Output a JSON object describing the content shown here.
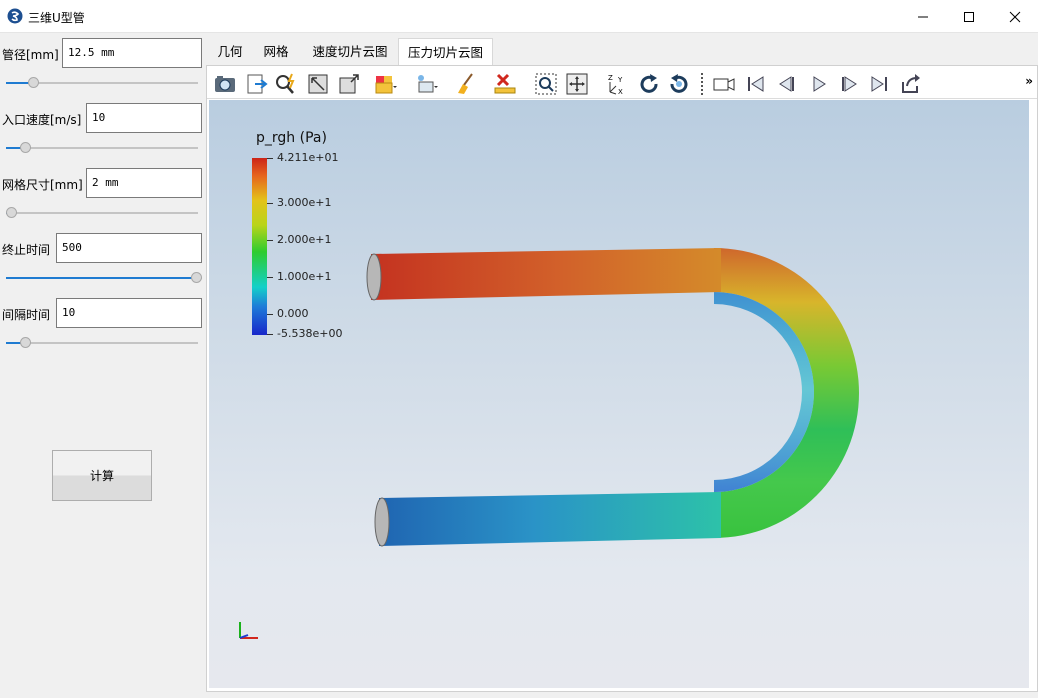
{
  "window": {
    "title": "三维U型管"
  },
  "params": [
    {
      "label": "管径[mm]",
      "value": "12.5 mm",
      "slider": 0.12
    },
    {
      "label": "入口速度[m/s]",
      "value": "10",
      "slider": 0.08
    },
    {
      "label": "网格尺寸[mm]",
      "value": "2 mm",
      "slider": 0.0
    },
    {
      "label": "终止时间",
      "value": "500",
      "slider": 1.0
    },
    {
      "label": "间隔时间",
      "value": "10",
      "slider": 0.08
    }
  ],
  "calc_button": "计算",
  "tabs": [
    "几何",
    "网格",
    "速度切片云图",
    "压力切片云图"
  ],
  "active_tab": 3,
  "toolbar_icons": [
    "camera-icon",
    "export-icon",
    "query-icon",
    "reset-camera-icon",
    "resize-icon",
    "select-cells-icon",
    "select-points-icon",
    "clear-icon",
    "delete-icon",
    "zoom-to-box-icon",
    "zoom-to-data-icon",
    "axes-orientation-icon",
    "rotate-cw-icon",
    "rotate-ccw-icon",
    "record-icon",
    "first-frame-icon",
    "prev-frame-icon",
    "play-icon",
    "next-frame-icon",
    "last-frame-icon",
    "loop-icon"
  ],
  "toolbar_more": "»",
  "legend": {
    "title": "p_rgh (Pa)",
    "labels": [
      "4.211e+01",
      "3.000e+1",
      "2.000e+1",
      "1.000e+1",
      "0.000",
      "-5.538e+00"
    ]
  },
  "colors": {
    "max": "#cc2418",
    "high": "#e3c31a",
    "mid": "#2ecc2e",
    "low": "#12d0c9",
    "min": "#1826ca",
    "accent": "#1f7bd1"
  }
}
